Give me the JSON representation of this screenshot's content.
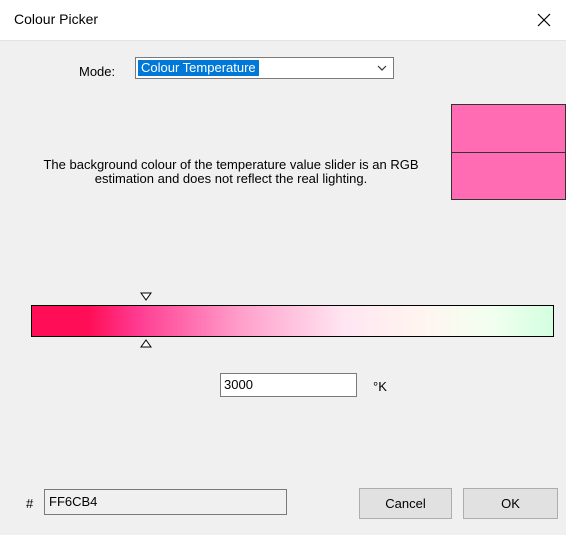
{
  "window": {
    "title": "Colour Picker",
    "close_glyph": "✕"
  },
  "mode": {
    "label": "Mode:",
    "selected": "Colour Temperature"
  },
  "swatch": {
    "current_color": "#ff6cb4",
    "previous_color": "#ff6cb4"
  },
  "note": "The background colour of the temperature value slider is an RGB estimation and does not reflect the real lighting.",
  "temperature": {
    "value": "3000",
    "unit": "°K",
    "slider_position_fraction": 0.22
  },
  "hex": {
    "hash_label": "#",
    "value": "FF6CB4"
  },
  "buttons": {
    "cancel": "Cancel",
    "ok": "OK"
  },
  "colors": {
    "selection_highlight": "#0078d7",
    "dialog_bg": "#f0f0f0"
  }
}
